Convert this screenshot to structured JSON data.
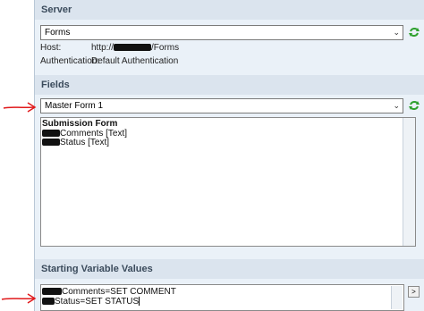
{
  "server": {
    "header": "Server",
    "select_value": "Forms",
    "host_label": "Host:",
    "host_value_prefix": "http://",
    "host_value_suffix": "/Forms",
    "auth_label": "Authentication:",
    "auth_value": "Default Authentication"
  },
  "fields": {
    "header": "Fields",
    "select_value": "Master Form 1",
    "list_title": "Submission Form",
    "items": [
      "Comments [Text]",
      "Status [Text]"
    ]
  },
  "variables": {
    "header": "Starting Variable Values",
    "lines": [
      "Comments=SET COMMENT",
      "Status=SET STATUS"
    ],
    "button_label": ">"
  },
  "colors": {
    "panel": "#eaf1f8",
    "header": "#dbe4ee",
    "arrow": "#e0191b",
    "refresh": "#2fa12f"
  },
  "icons": {
    "refresh": "refresh-icon",
    "dropdown": "chevron-down-icon",
    "annotation": "red-arrow"
  }
}
